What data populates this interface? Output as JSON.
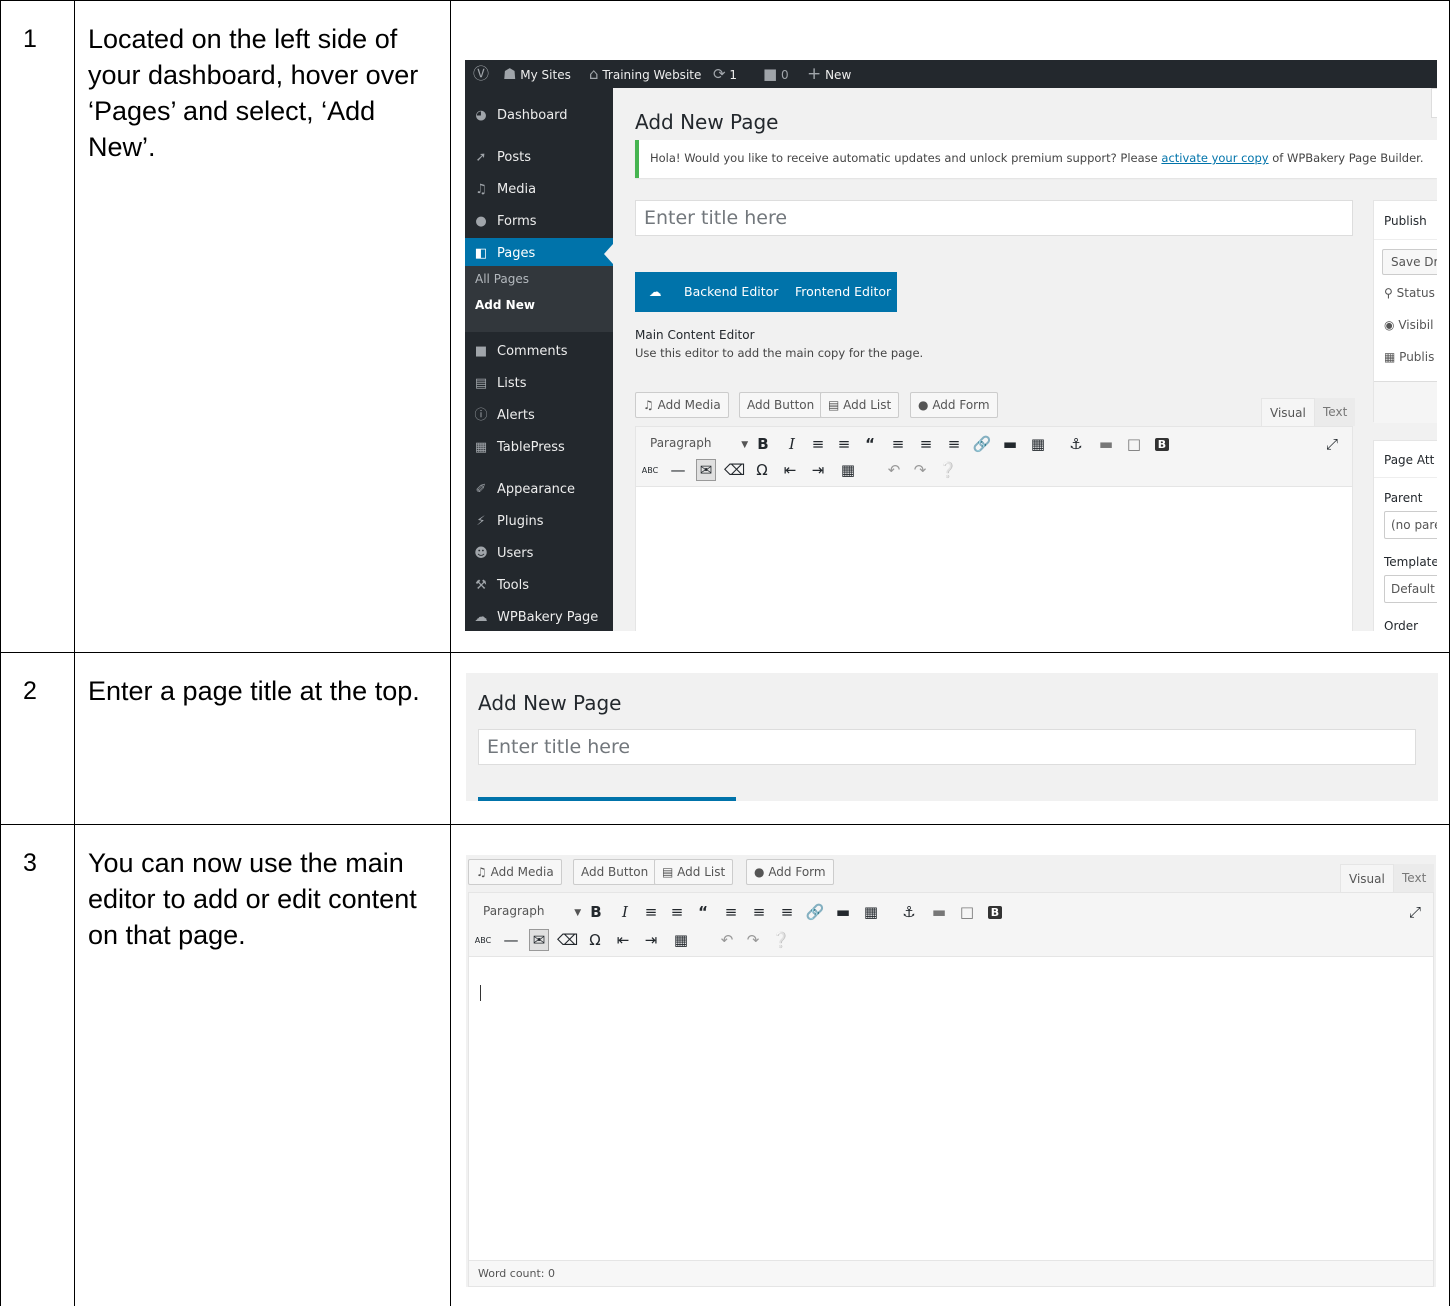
{
  "steps": [
    {
      "number": "1",
      "text": "Located on the left side of your dashboard, hover over ‘Pages’ and select, ‘Add New’."
    },
    {
      "number": "2",
      "text": "Enter a page title at the top."
    },
    {
      "number": "3",
      "text": "You can now use the main editor to add or edit content on that page."
    }
  ],
  "admin_bar": {
    "my_sites": "My Sites",
    "site_name": "Training Website",
    "updates_count": "1",
    "comments_count": "0",
    "new_label": "New"
  },
  "sidebar": {
    "items": [
      {
        "label": "Dashboard",
        "icon": "dashboard-icon"
      },
      {
        "label": "Posts",
        "icon": "pin-icon"
      },
      {
        "label": "Media",
        "icon": "media-icon"
      },
      {
        "label": "Forms",
        "icon": "forms-icon"
      },
      {
        "label": "Pages",
        "icon": "pages-icon"
      },
      {
        "label": "Comments",
        "icon": "comment-icon"
      },
      {
        "label": "Lists",
        "icon": "lists-icon"
      },
      {
        "label": "Alerts",
        "icon": "info-icon"
      },
      {
        "label": "TablePress",
        "icon": "table-icon"
      },
      {
        "label": "Appearance",
        "icon": "brush-icon"
      },
      {
        "label": "Plugins",
        "icon": "plugin-icon"
      },
      {
        "label": "Users",
        "icon": "users-icon"
      },
      {
        "label": "Tools",
        "icon": "wrench-icon"
      },
      {
        "label": "WPBakery Page",
        "icon": "wpbakery-icon"
      }
    ],
    "sub_items": [
      "All Pages",
      "Add New"
    ]
  },
  "editor": {
    "page_heading": "Add New Page",
    "notice_text": "Hola! Would you like to receive automatic updates and unlock premium support? Please",
    "notice_link": "activate your copy",
    "notice_suffix": "of WPBakery Page Builder.",
    "title_placeholder": "Enter title here",
    "backend_editor": "Backend Editor",
    "frontend_editor": "Frontend Editor",
    "main_content_title": "Main Content Editor",
    "main_content_desc": "Use this editor to add the main copy for the page.",
    "add_media": "Add Media",
    "add_button": "Add Button",
    "add_list": "Add List",
    "add_form": "Add Form",
    "tab_visual": "Visual",
    "tab_text": "Text",
    "format_select": "Paragraph",
    "word_count": "Word count: 0"
  },
  "publish_box": {
    "title": "Publish",
    "save_draft": "Save Dra",
    "status": "Status",
    "visibility": "Visibil",
    "publish": "Publis"
  },
  "page_attributes": {
    "title": "Page Att",
    "parent_label": "Parent",
    "parent_value": "(no pare",
    "template_label": "Template",
    "template_value": "Default",
    "order_label": "Order"
  },
  "colors": {
    "admin_dark": "#23282d",
    "wp_blue": "#0073aa",
    "notice_green": "#46b450",
    "background": "#f1f1f1"
  }
}
